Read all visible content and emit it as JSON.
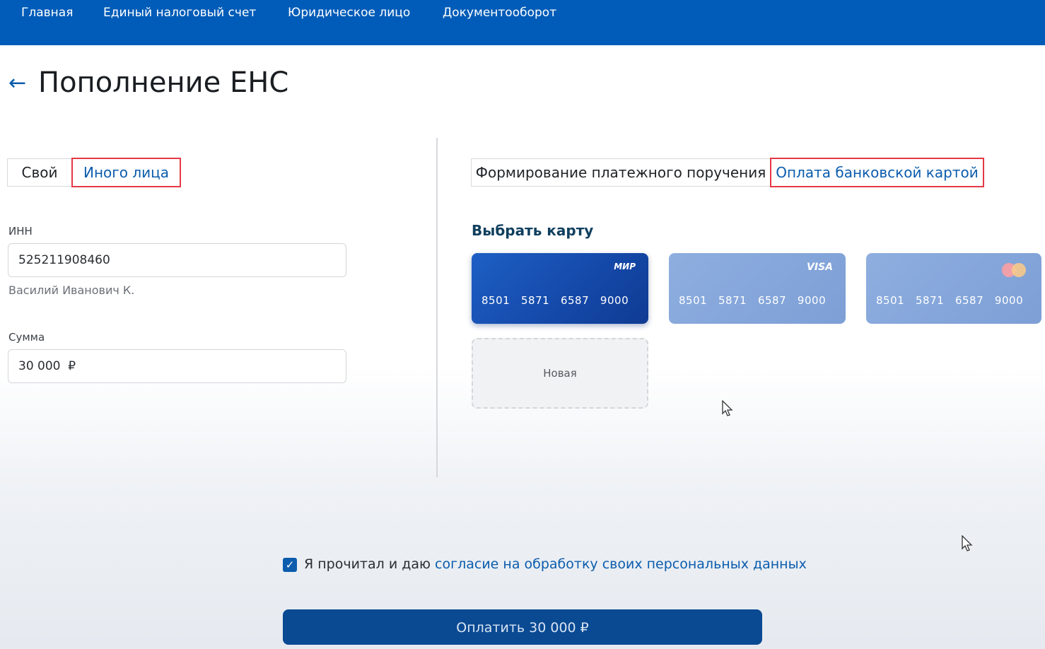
{
  "nav": {
    "items": [
      {
        "label": "Главная"
      },
      {
        "label": "Единый налоговый счет"
      },
      {
        "label": "Юридическое лицо"
      },
      {
        "label": "Документооборот"
      }
    ]
  },
  "header": {
    "back_icon": "arrow-left-icon",
    "title": "Пополнение ЕНС"
  },
  "payer_toggle": {
    "options": [
      "Свой",
      "Иного лица"
    ],
    "selected": "Иного лица"
  },
  "form": {
    "inn_label": "ИНН",
    "inn_value": "525211908460",
    "inn_owner": "Василий Иванович К.",
    "amount_label": "Сумма",
    "amount_value": "30 000  ₽"
  },
  "method_toggle": {
    "options": [
      "Формирование платежного поручения",
      "Оплата банковской картой"
    ],
    "selected": "Оплата банковской картой"
  },
  "cards": {
    "section_title": "Выбрать карту",
    "items": [
      {
        "brand": "МИР",
        "number": "8501   5871   6587   9000",
        "selected": true
      },
      {
        "brand": "VISA",
        "number": "8501   5871   6587   9000",
        "selected": false
      },
      {
        "brand": "mastercard-logo",
        "number": "8501   5871   6587   9000",
        "selected": false
      }
    ],
    "new_card_label": "Новая"
  },
  "consent": {
    "checked": true,
    "text_prefix": "Я прочитал и даю ",
    "text_link": "согласие на обработку своих персональных данных"
  },
  "pay_button": {
    "label": "Оплатить 30 000 ₽"
  },
  "colors": {
    "nav_bg": "#005cb8",
    "accent": "#0b5cad",
    "highlight_border": "#e53945",
    "pay_button_bg": "#0a4a93"
  }
}
